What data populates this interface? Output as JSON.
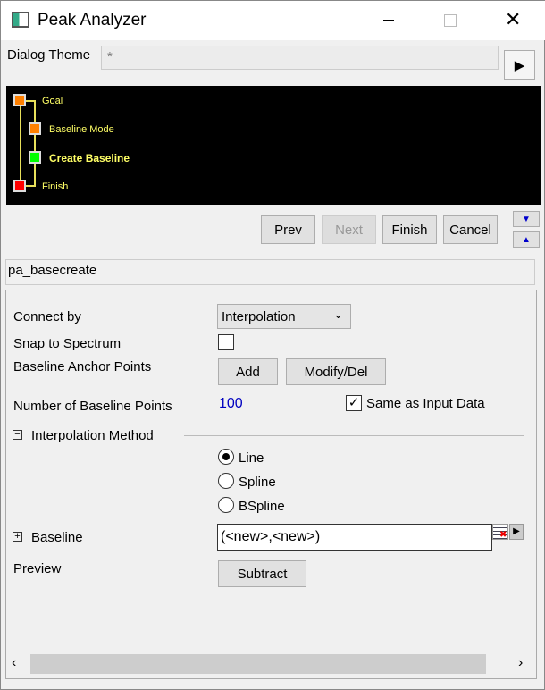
{
  "window": {
    "title": "Peak Analyzer"
  },
  "theme": {
    "label": "Dialog Theme",
    "value": "*"
  },
  "tree": [
    {
      "label": "Goal",
      "color": "#ff8000"
    },
    {
      "label": "Baseline Mode",
      "color": "#ff8000"
    },
    {
      "label": "Create Baseline",
      "color": "#00ff00"
    },
    {
      "label": "Finish",
      "color": "#ff0000"
    }
  ],
  "nav": {
    "prev": "Prev",
    "next": "Next",
    "finish": "Finish",
    "cancel": "Cancel"
  },
  "page_name": "pa_basecreate",
  "form": {
    "connect_by_label": "Connect by",
    "connect_by_value": "Interpolation",
    "snap_label": "Snap to Spectrum",
    "snap_checked": false,
    "anchor_label": "Baseline Anchor Points",
    "add": "Add",
    "modify": "Modify/Del",
    "num_points_label": "Number of Baseline Points",
    "num_points": "100",
    "same_as_input": "Same as Input Data",
    "same_checked": true,
    "interp_section": "Interpolation Method",
    "methods": [
      "Line",
      "Spline",
      "BSpline"
    ],
    "selected_method": "Line",
    "baseline_label": "Baseline",
    "baseline_value": "(<new>,<new>)",
    "preview_label": "Preview",
    "subtract": "Subtract"
  }
}
